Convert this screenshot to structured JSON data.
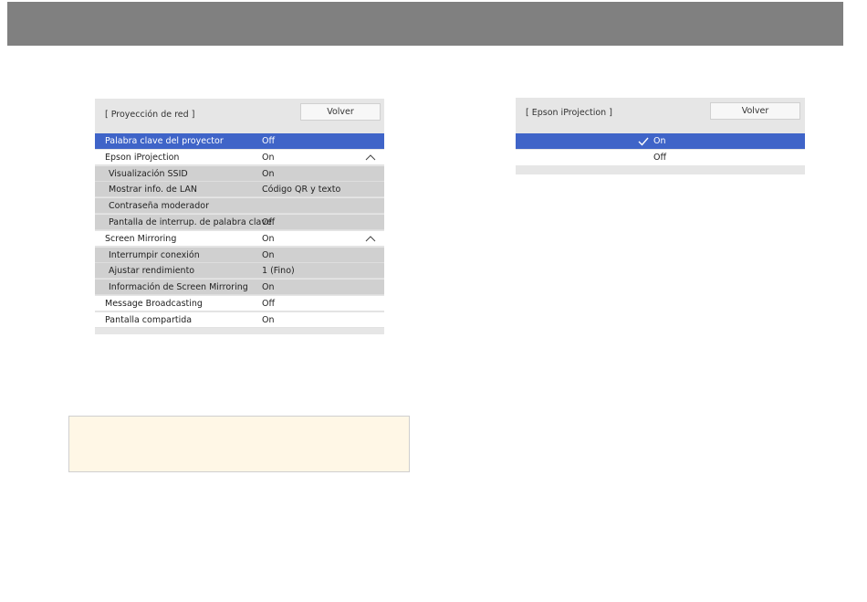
{
  "left_panel": {
    "title": "[ Proyección de red ]",
    "back_label": "Volver",
    "rows": [
      {
        "label": "Palabra clave del proyector",
        "value": "Off",
        "kind": "selected",
        "chevron": false
      },
      {
        "label": "Epson iProjection",
        "value": "On",
        "kind": "top",
        "chevron": true
      },
      {
        "label": "Visualización SSID",
        "value": "On",
        "kind": "sub",
        "chevron": false
      },
      {
        "label": "Mostrar info. de LAN",
        "value": "Código QR y texto",
        "kind": "sub",
        "chevron": false
      },
      {
        "label": "Contraseña moderador",
        "value": "",
        "kind": "sub",
        "chevron": false
      },
      {
        "label": "Pantalla de interrup. de palabra clave",
        "value": "Off",
        "kind": "sub",
        "chevron": false
      },
      {
        "label": "Screen Mirroring",
        "value": "On",
        "kind": "top",
        "chevron": true
      },
      {
        "label": "Interrumpir conexión",
        "value": "On",
        "kind": "sub",
        "chevron": false
      },
      {
        "label": "Ajustar rendimiento",
        "value": "1 (Fino)",
        "kind": "sub",
        "chevron": false
      },
      {
        "label": "Información de Screen Mirroring",
        "value": "On",
        "kind": "sub",
        "chevron": false
      },
      {
        "label": "Message Broadcasting",
        "value": "Off",
        "kind": "top",
        "chevron": false
      },
      {
        "label": "Pantalla compartida",
        "value": "On",
        "kind": "top",
        "chevron": false
      }
    ]
  },
  "right_panel": {
    "title": "[ Epson iProjection ]",
    "back_label": "Volver",
    "options": [
      {
        "label": "On",
        "selected": true
      },
      {
        "label": "Off",
        "selected": false
      }
    ]
  },
  "colors": {
    "header": "#808080",
    "selected": "#3f64c8",
    "panel": "#e6e6e6",
    "sub_row": "#d0d0d0",
    "note_bg": "#fff7e6"
  }
}
